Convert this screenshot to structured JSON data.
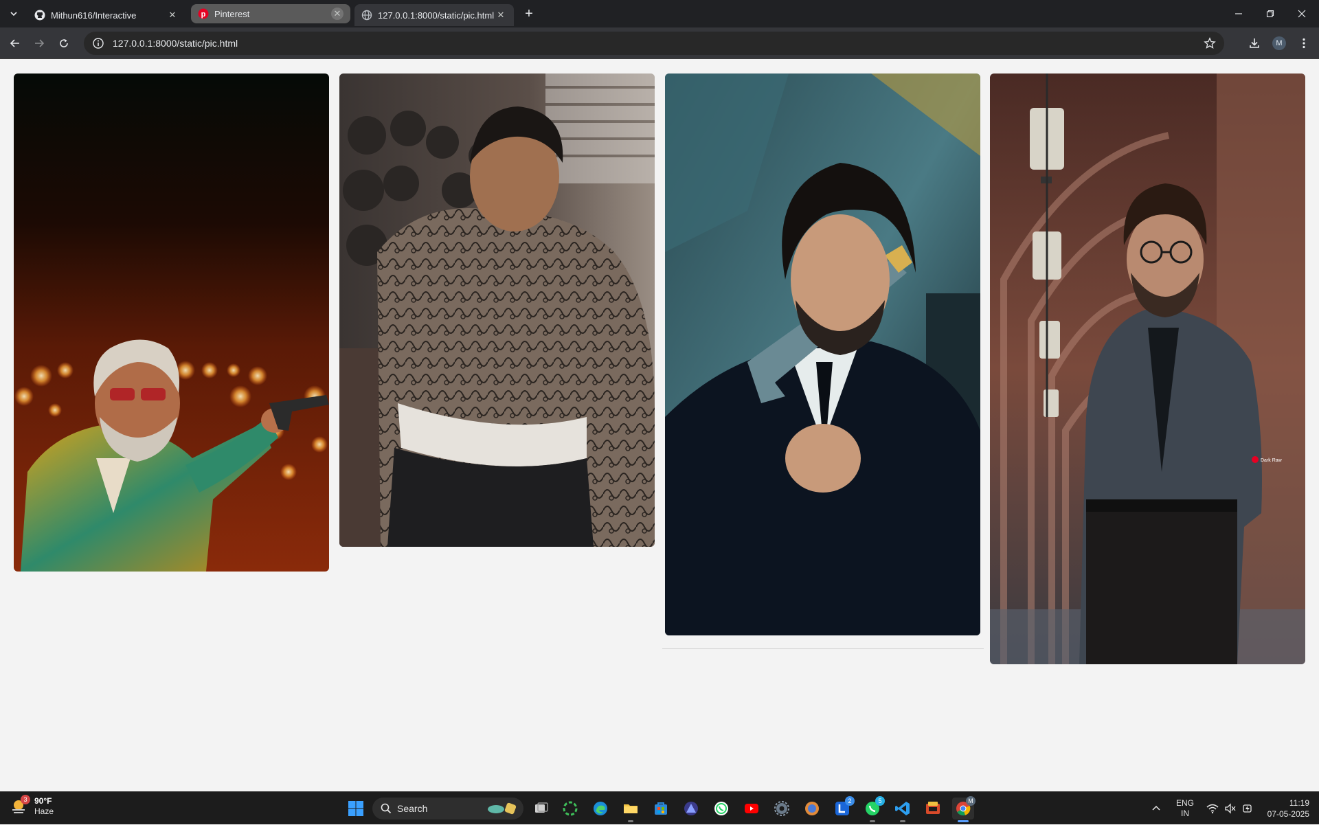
{
  "browser": {
    "tabs": [
      {
        "label": "Mithun616/Interactive",
        "icon": "github-icon"
      },
      {
        "label": "Pinterest",
        "icon": "pinterest-icon"
      },
      {
        "label": "127.0.0.1:8000/static/pic.html",
        "icon": "globe-icon"
      }
    ],
    "address": "127.0.0.1:8000/static/pic.html",
    "profile_initial": "M"
  },
  "gallery": {
    "images": [
      {
        "subject": "man in floral shirt and sunglasses aiming pistol, bokeh lights"
      },
      {
        "subject": "tattooed muscular man with bandaged waist, crowd behind"
      },
      {
        "subject": "long-haired man in dark suit holding pistol"
      },
      {
        "subject": "bearded man with glasses and tie in arched corridor"
      }
    ],
    "watermark": "Dark Raw"
  },
  "taskbar": {
    "weather_badge": "3",
    "temperature": "90°F",
    "condition": "Haze",
    "search_label": "Search",
    "lens_badge": "2",
    "whatsapp_badge": "5",
    "chrome_badge": "M",
    "language": "ENG",
    "region": "IN",
    "time": "11:19",
    "date": "07-05-2025"
  }
}
